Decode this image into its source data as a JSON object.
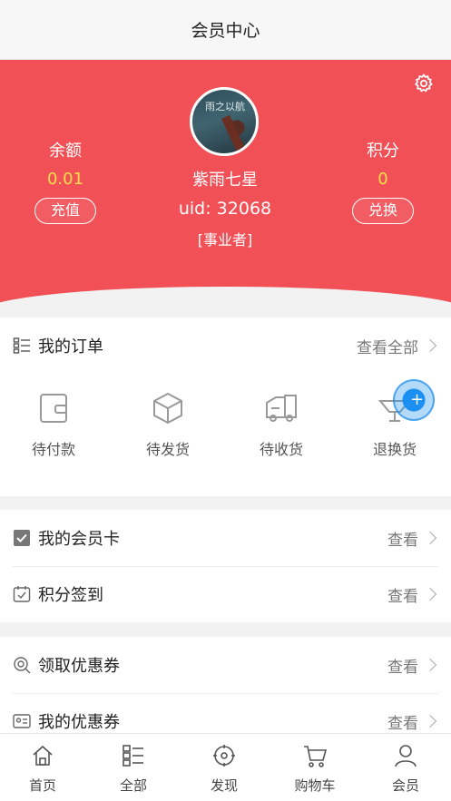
{
  "nav": {
    "title": "会员中心"
  },
  "profile": {
    "name": "紫雨七星",
    "uid": "uid: 32068",
    "role": "[事业者]",
    "avatar_text": "雨之以航",
    "balance_label": "余额",
    "balance_value": "0.01",
    "recharge_label": "充值",
    "points_label": "积分",
    "points_value": "0",
    "exchange_label": "兑换",
    "settings_icon": "gear-icon"
  },
  "orders": {
    "title": "我的订单",
    "view_all": "查看全部",
    "items": [
      {
        "label": "待付款",
        "icon": "wallet-icon"
      },
      {
        "label": "待发货",
        "icon": "box-icon"
      },
      {
        "label": "待收货",
        "icon": "truck-icon"
      },
      {
        "label": "退换货",
        "icon": "return-icon"
      }
    ]
  },
  "menu": [
    {
      "label": "我的会员卡",
      "action": "查看",
      "icon": "checkbox-icon"
    },
    {
      "label": "积分签到",
      "action": "查看",
      "icon": "calendar-check-icon"
    },
    {
      "label": "领取优惠券",
      "action": "查看",
      "icon": "coupon-search-icon"
    },
    {
      "label": "我的优惠券",
      "action": "查看",
      "icon": "id-card-icon"
    }
  ],
  "tabs": [
    {
      "label": "首页",
      "icon": "home-icon"
    },
    {
      "label": "全部",
      "icon": "list-icon"
    },
    {
      "label": "发现",
      "icon": "compass-icon"
    },
    {
      "label": "购物车",
      "icon": "cart-icon"
    },
    {
      "label": "会员",
      "icon": "user-icon"
    }
  ],
  "colors": {
    "hero": "#f05056",
    "accent_yellow": "#ffe04a",
    "fab": "#1b8ff2"
  }
}
